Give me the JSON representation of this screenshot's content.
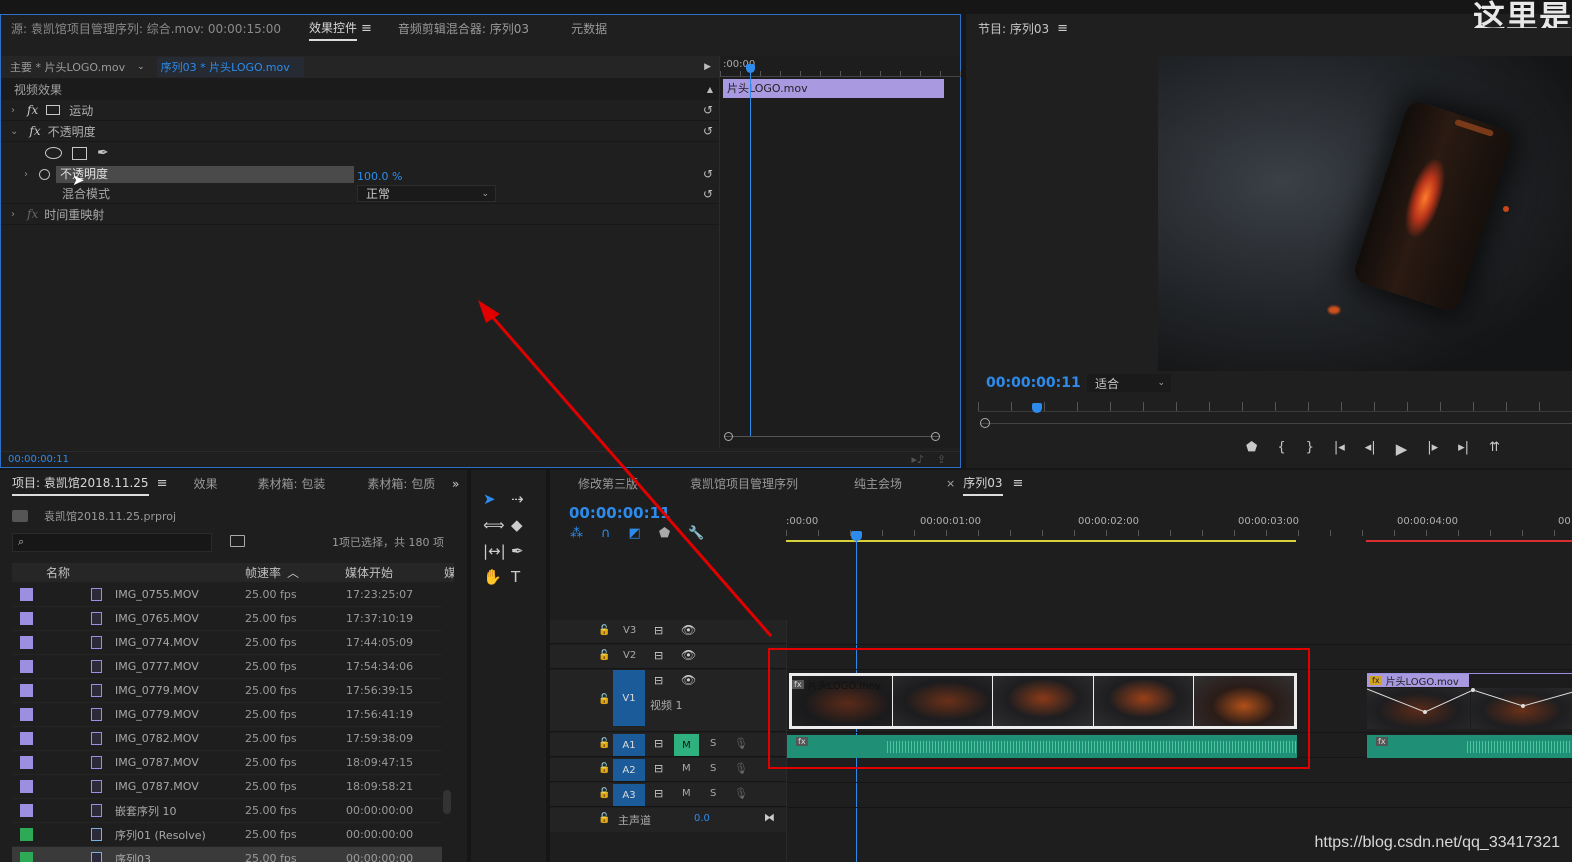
{
  "colors": {
    "accent": "#2d8ceb",
    "clip_purple": "#a899e0",
    "audio_green": "#1f8f76",
    "red_box": "#e00000",
    "work_yellow": "#d8d23a"
  },
  "effect_controls": {
    "tabs": [
      {
        "label": "源: 袁凯馆项目管理序列: 综合.mov: 00:00:15:00"
      },
      {
        "label": "效果控件",
        "active": true
      },
      {
        "label": "音频剪辑混合器: 序列03"
      },
      {
        "label": "元数据"
      }
    ],
    "master_label": "主要 * 片头LOGO.mov",
    "sequence_label": "序列03 * 片头LOGO.mov",
    "section_label": "视频效果",
    "fx_rows": [
      {
        "name": "运动"
      },
      {
        "name": "不透明度"
      }
    ],
    "opacity_param": {
      "name": "不透明度",
      "value": "100.0 %"
    },
    "blend_mode": {
      "name": "混合模式",
      "value": "正常"
    },
    "time_remap": "时间重映射",
    "mini_timecode": ":00:00",
    "mini_clip": "片头LOGO.mov",
    "timecode": "00:00:00:11"
  },
  "program": {
    "title": "节目: 序列03",
    "timecode": "00:00:00:11",
    "fit": "适合",
    "corner_text": "这里是"
  },
  "project": {
    "tabs": [
      {
        "label": "项目: 袁凯馆2018.11.25",
        "active": true
      },
      {
        "label": "效果"
      },
      {
        "label": "素材箱: 包装"
      },
      {
        "label": "素材箱: 包质"
      }
    ],
    "file": "袁凯馆2018.11.25.prproj",
    "selection": "1项已选择，共 180 项",
    "search_placeholder": "",
    "columns": [
      "名称",
      "帧速率",
      "媒体开始",
      "媒"
    ],
    "rows": [
      {
        "name": "IMG_0755.MOV",
        "fps": "25.00 fps",
        "start": "17:23:25:07",
        "color": "#9c8ee0",
        "type": "clip"
      },
      {
        "name": "IMG_0765.MOV",
        "fps": "25.00 fps",
        "start": "17:37:10:19",
        "color": "#9c8ee0",
        "type": "clip"
      },
      {
        "name": "IMG_0774.MOV",
        "fps": "25.00 fps",
        "start": "17:44:05:09",
        "color": "#9c8ee0",
        "type": "clip"
      },
      {
        "name": "IMG_0777.MOV",
        "fps": "25.00 fps",
        "start": "17:54:34:06",
        "color": "#9c8ee0",
        "type": "clip"
      },
      {
        "name": "IMG_0779.MOV",
        "fps": "25.00 fps",
        "start": "17:56:39:15",
        "color": "#9c8ee0",
        "type": "clip"
      },
      {
        "name": "IMG_0779.MOV",
        "fps": "25.00 fps",
        "start": "17:56:41:19",
        "color": "#9c8ee0",
        "type": "clip"
      },
      {
        "name": "IMG_0782.MOV",
        "fps": "25.00 fps",
        "start": "17:59:38:09",
        "color": "#9c8ee0",
        "type": "clip"
      },
      {
        "name": "IMG_0787.MOV",
        "fps": "25.00 fps",
        "start": "18:09:47:15",
        "color": "#9c8ee0",
        "type": "clip"
      },
      {
        "name": "IMG_0787.MOV",
        "fps": "25.00 fps",
        "start": "18:09:58:21",
        "color": "#9c8ee0",
        "type": "clip"
      },
      {
        "name": "嵌套序列 10",
        "fps": "25.00 fps",
        "start": "00:00:00:00",
        "color": "#9c8ee0",
        "type": "clip"
      },
      {
        "name": "序列01 (Resolve)",
        "fps": "25.00 fps",
        "start": "00:00:00:00",
        "color": "#2eaa56",
        "type": "sequence"
      },
      {
        "name": "序列03",
        "fps": "25.00 fps",
        "start": "00:00:00:00",
        "color": "#2eaa56",
        "type": "sequence"
      }
    ]
  },
  "timeline": {
    "tabs": [
      {
        "label": "修改第三版"
      },
      {
        "label": "袁凯馆项目管理序列"
      },
      {
        "label": "纯主会场"
      },
      {
        "label": "序列03",
        "active": true
      }
    ],
    "timecode": "00:00:00:11",
    "ruler": [
      ":00:00",
      "00:00:01:00",
      "00:00:02:00",
      "00:00:03:00",
      "00:00:04:00",
      "00"
    ],
    "video_tracks": [
      {
        "id": "V3",
        "label": ""
      },
      {
        "id": "V2",
        "label": ""
      },
      {
        "id": "V1",
        "label": "视频 1"
      }
    ],
    "audio_tracks": [
      {
        "id": "A1",
        "m": "M",
        "s": "S"
      },
      {
        "id": "A2",
        "m": "M",
        "s": "S"
      },
      {
        "id": "A3",
        "m": "M",
        "s": "S"
      }
    ],
    "master": {
      "label": "主声道",
      "value": "0.0"
    },
    "clip1": "片头LOGO.mov",
    "clip2": "片头LOGO.mov"
  },
  "watermark": "https://blog.csdn.net/qq_33417321"
}
